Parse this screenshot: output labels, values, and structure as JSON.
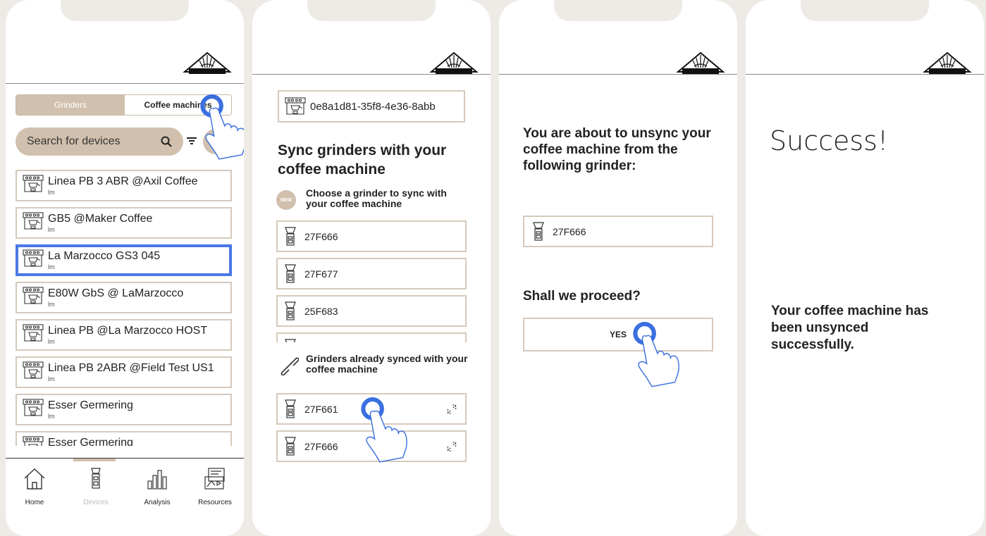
{
  "brand": {
    "logo_text": "MAHLKÖNIG"
  },
  "screen1": {
    "tabs": [
      "Grinders",
      "Coffee machines"
    ],
    "search_placeholder": "Search for devices",
    "devices": [
      {
        "name": "Linea PB 3 ABR @Axil Coffee",
        "sub": "lm"
      },
      {
        "name": "GB5 @Maker Coffee",
        "sub": "lm"
      },
      {
        "name": "La Marzocco GS3 045",
        "sub": "lm"
      },
      {
        "name": "E80W GbS @ LaMarzocco",
        "sub": "lm"
      },
      {
        "name": "Linea PB @La Marzocco HOST",
        "sub": "lm"
      },
      {
        "name": "Linea PB 2ABR @Field Test US1",
        "sub": "lm"
      },
      {
        "name": "Esser Germering",
        "sub": "lm"
      },
      {
        "name": "Esser Germering",
        "sub": ""
      }
    ],
    "nav": [
      "Home",
      "Devices",
      "Analysis",
      "Resources"
    ]
  },
  "screen2": {
    "machine_id": "0e8a1d81-35f8-4e36-8abb",
    "title": "Sync grinders with your coffee machine",
    "new_badge": "NEW",
    "choose_label": "Choose a grinder to sync with your coffee machine",
    "available": [
      "27F666",
      "27F677",
      "25F683"
    ],
    "synced_label": "Grinders already synced with your coffee machine",
    "synced": [
      "27F661",
      "27F666"
    ]
  },
  "screen3": {
    "warning": "You are about to unsync your coffee machine from the following grinder:",
    "grinder": "27F666",
    "question": "Shall we proceed?",
    "confirm": "YES"
  },
  "screen4": {
    "title": "Success!",
    "message": "Your coffee machine has been unsynced successfully."
  },
  "colors": {
    "accent": "#d1c0ad",
    "selected_border": "#4a78e6",
    "tap": "#3b6fe0"
  }
}
